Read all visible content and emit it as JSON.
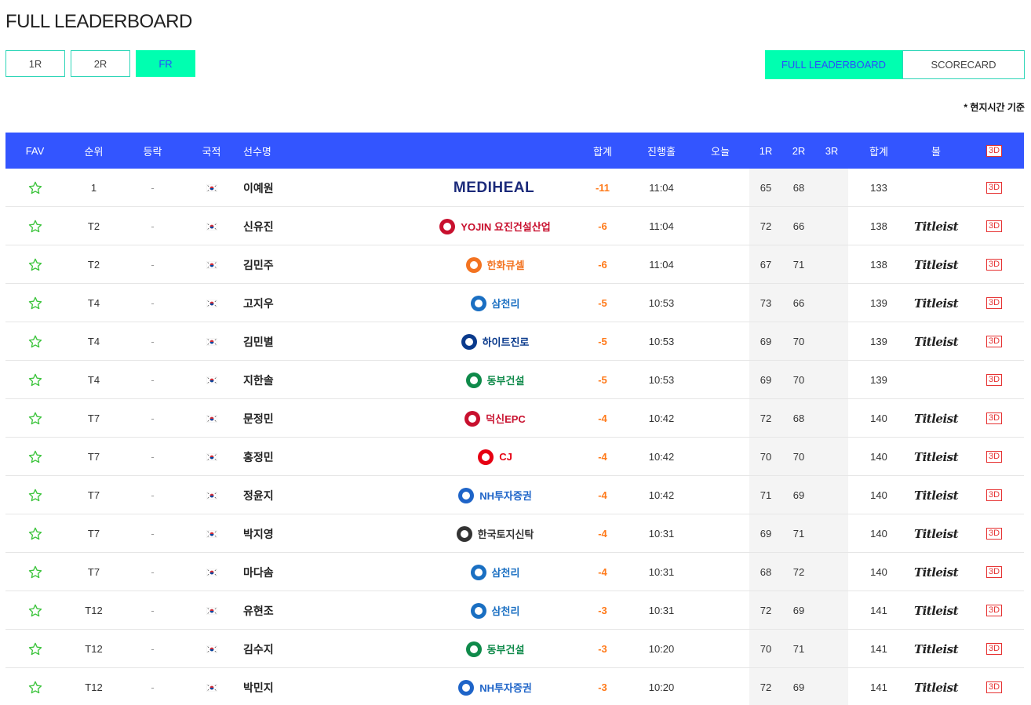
{
  "title": "FULL LEADERBOARD",
  "round_tabs": [
    "1R",
    "2R",
    "FR"
  ],
  "active_round": "FR",
  "view_tabs": {
    "full": "FULL LEADERBOARD",
    "scorecard": "SCORECARD"
  },
  "timezone_note": "* 현지시간 기준",
  "columns": {
    "fav": "FAV",
    "rank": "순위",
    "move": "등락",
    "nation": "국적",
    "name": "선수명",
    "total": "합계",
    "hole": "진행홀",
    "today": "오늘",
    "r1": "1R",
    "r2": "2R",
    "r3": "3R",
    "sum": "합계",
    "ball": "볼",
    "three_d": "3D"
  },
  "colors": {
    "header_bg": "#3355ff",
    "accent": "#00ffb0",
    "score": "#ff7a1a",
    "badge": "#e63333"
  },
  "rows": [
    {
      "rank": "1",
      "move": "-",
      "name": "이예원",
      "sponsor": "MEDIHEAL",
      "sponsor_icon": "mediheal-logo",
      "total": "-11",
      "hole": "11:04",
      "r1": "65",
      "r2": "68",
      "sum": "133",
      "ball": "",
      "three_d": "3D"
    },
    {
      "rank": "T2",
      "move": "-",
      "name": "신유진",
      "sponsor": "YOJIN 요진건설산업",
      "sponsor_icon": "yojin-logo",
      "total": "-6",
      "hole": "11:04",
      "r1": "72",
      "r2": "66",
      "sum": "138",
      "ball": "Titleist",
      "three_d": "3D"
    },
    {
      "rank": "T2",
      "move": "-",
      "name": "김민주",
      "sponsor": "한화큐셀",
      "sponsor_icon": "hanwha-logo",
      "total": "-6",
      "hole": "11:04",
      "r1": "67",
      "r2": "71",
      "sum": "138",
      "ball": "Titleist",
      "three_d": "3D"
    },
    {
      "rank": "T4",
      "move": "-",
      "name": "고지우",
      "sponsor": "삼천리",
      "sponsor_icon": "samchully-logo",
      "total": "-5",
      "hole": "10:53",
      "r1": "73",
      "r2": "66",
      "sum": "139",
      "ball": "Titleist",
      "three_d": "3D"
    },
    {
      "rank": "T4",
      "move": "-",
      "name": "김민별",
      "sponsor": "하이트진로",
      "sponsor_icon": "hitejinro-logo",
      "total": "-5",
      "hole": "10:53",
      "r1": "69",
      "r2": "70",
      "sum": "139",
      "ball": "Titleist",
      "three_d": "3D"
    },
    {
      "rank": "T4",
      "move": "-",
      "name": "지한솔",
      "sponsor": "동부건설",
      "sponsor_icon": "dongbu-logo",
      "total": "-5",
      "hole": "10:53",
      "r1": "69",
      "r2": "70",
      "sum": "139",
      "ball": "",
      "three_d": "3D"
    },
    {
      "rank": "T7",
      "move": "-",
      "name": "문정민",
      "sponsor": "덕신EPC",
      "sponsor_icon": "duckshin-logo",
      "total": "-4",
      "hole": "10:42",
      "r1": "72",
      "r2": "68",
      "sum": "140",
      "ball": "Titleist",
      "three_d": "3D"
    },
    {
      "rank": "T7",
      "move": "-",
      "name": "홍정민",
      "sponsor": "CJ",
      "sponsor_icon": "cj-logo",
      "total": "-4",
      "hole": "10:42",
      "r1": "70",
      "r2": "70",
      "sum": "140",
      "ball": "Titleist",
      "three_d": "3D"
    },
    {
      "rank": "T7",
      "move": "-",
      "name": "정윤지",
      "sponsor": "NH투자증권",
      "sponsor_icon": "nh-logo",
      "total": "-4",
      "hole": "10:42",
      "r1": "71",
      "r2": "69",
      "sum": "140",
      "ball": "Titleist",
      "three_d": "3D"
    },
    {
      "rank": "T7",
      "move": "-",
      "name": "박지영",
      "sponsor": "한국토지신탁",
      "sponsor_icon": "koreit-logo",
      "total": "-4",
      "hole": "10:31",
      "r1": "69",
      "r2": "71",
      "sum": "140",
      "ball": "Titleist",
      "three_d": "3D"
    },
    {
      "rank": "T7",
      "move": "-",
      "name": "마다솜",
      "sponsor": "삼천리",
      "sponsor_icon": "samchully-logo",
      "total": "-4",
      "hole": "10:31",
      "r1": "68",
      "r2": "72",
      "sum": "140",
      "ball": "Titleist",
      "three_d": "3D"
    },
    {
      "rank": "T12",
      "move": "-",
      "name": "유현조",
      "sponsor": "삼천리",
      "sponsor_icon": "samchully-logo",
      "total": "-3",
      "hole": "10:31",
      "r1": "72",
      "r2": "69",
      "sum": "141",
      "ball": "Titleist",
      "three_d": "3D"
    },
    {
      "rank": "T12",
      "move": "-",
      "name": "김수지",
      "sponsor": "동부건설",
      "sponsor_icon": "dongbu-logo",
      "total": "-3",
      "hole": "10:20",
      "r1": "70",
      "r2": "71",
      "sum": "141",
      "ball": "Titleist",
      "three_d": "3D"
    },
    {
      "rank": "T12",
      "move": "-",
      "name": "박민지",
      "sponsor": "NH투자증권",
      "sponsor_icon": "nh-logo",
      "total": "-3",
      "hole": "10:20",
      "r1": "72",
      "r2": "69",
      "sum": "141",
      "ball": "Titleist",
      "three_d": "3D"
    }
  ]
}
